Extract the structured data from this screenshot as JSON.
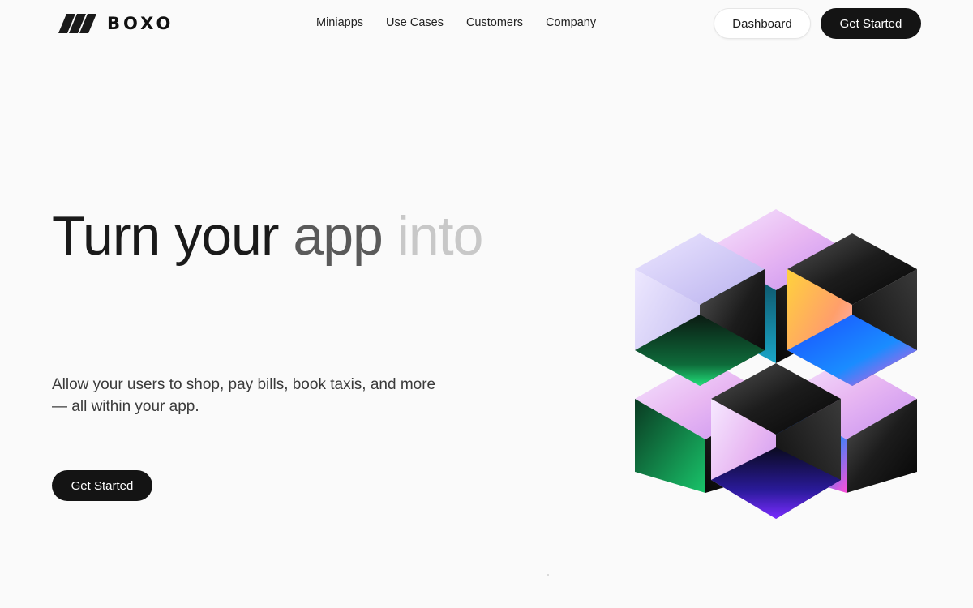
{
  "brand": {
    "name": "BOXO"
  },
  "nav": {
    "items": [
      {
        "label": "Miniapps"
      },
      {
        "label": "Use Cases"
      },
      {
        "label": "Customers"
      },
      {
        "label": "Company"
      }
    ]
  },
  "header": {
    "dashboard_label": "Dashboard",
    "get_started_label": "Get Started"
  },
  "hero": {
    "title_words": [
      "Turn",
      "your",
      "app",
      "into"
    ],
    "subtitle": "Allow your users to shop, pay bills, book taxis, and more — all within your app.",
    "cta_label": "Get Started"
  },
  "colors": {
    "background": "#fafafa",
    "primary_button": "#141414",
    "text_dark": "#1a1a1a",
    "text_mid": "#5a5a5a",
    "text_light": "#c8c8c8"
  },
  "icons": {
    "logo_mark": "boxo-slashes-logo-icon",
    "hero_art": "iridescent-cubes-illustration"
  }
}
